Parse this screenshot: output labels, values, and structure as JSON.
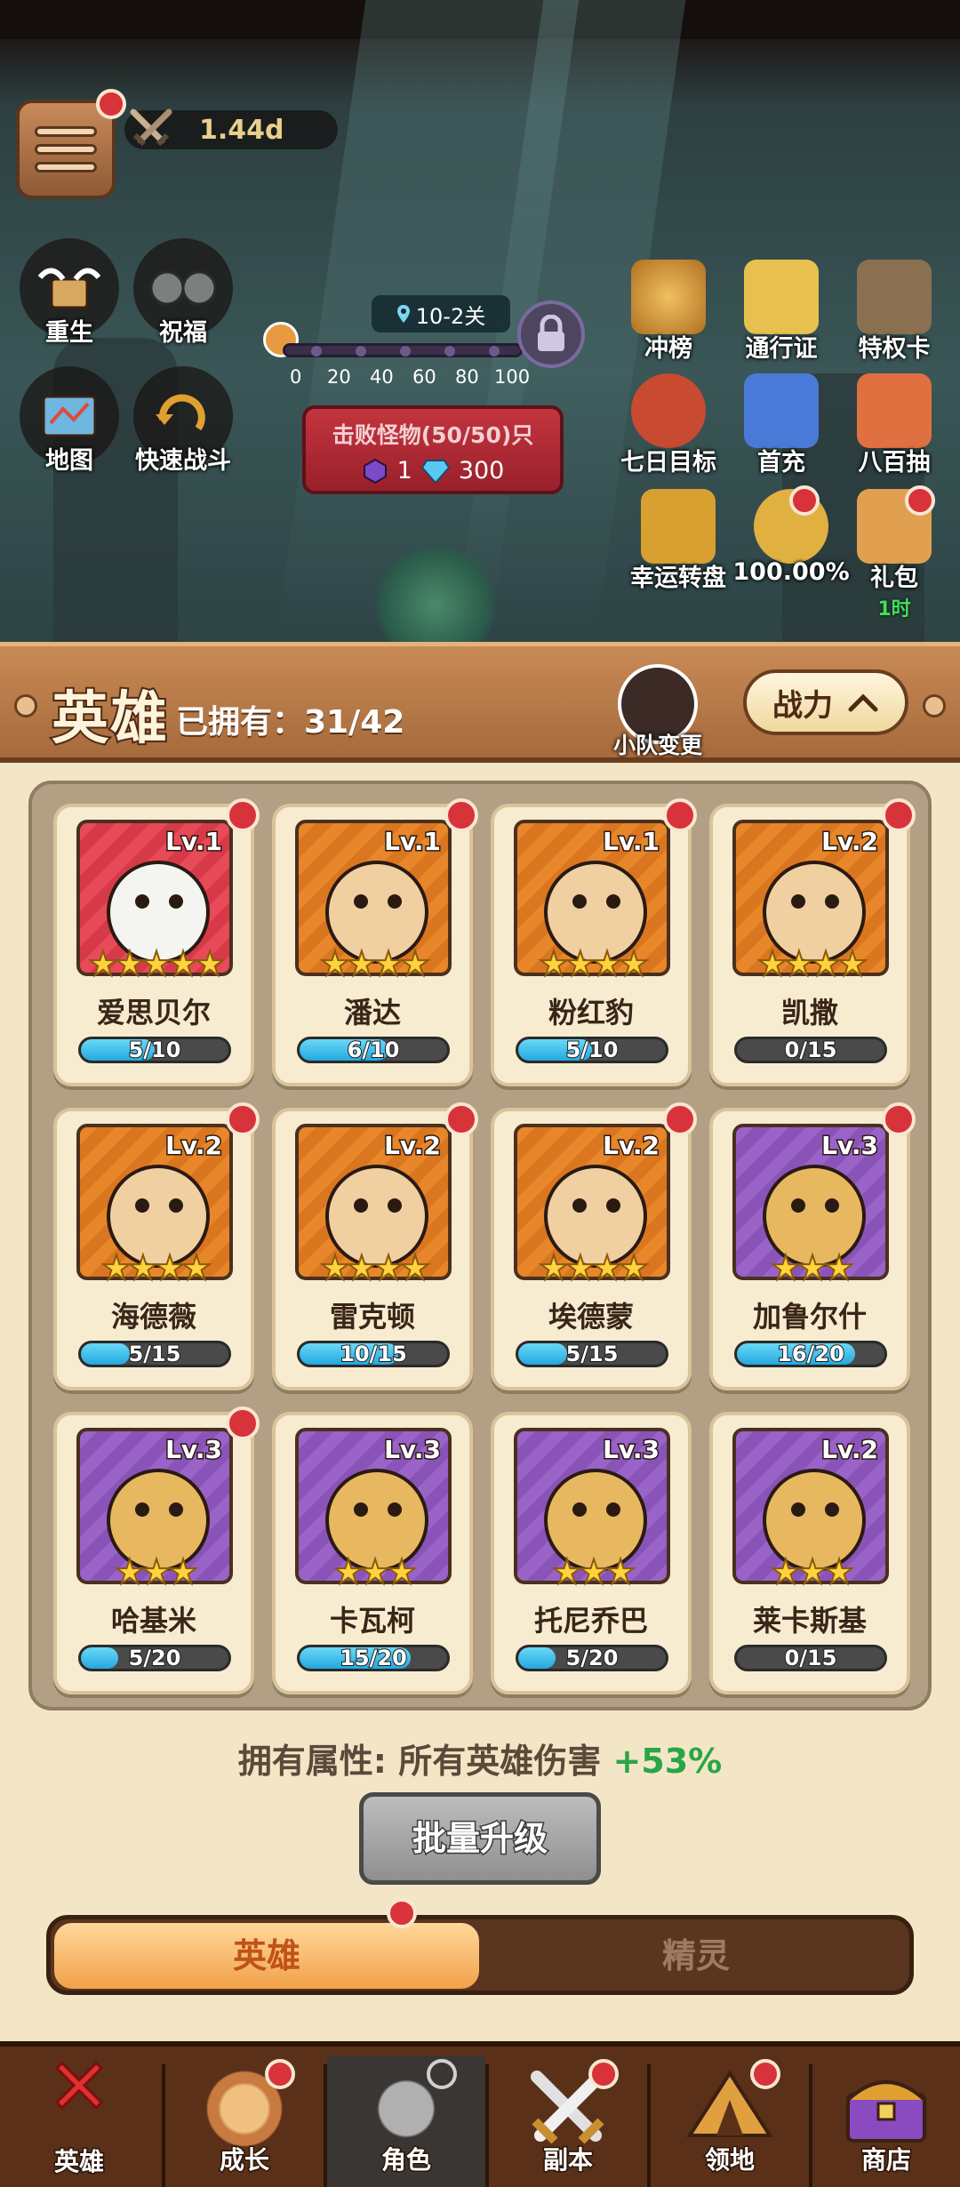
{
  "top": {
    "power_value": "1.44d",
    "left_buttons": [
      {
        "label": "重生",
        "icon": "angel-chest-icon"
      },
      {
        "label": "祝福",
        "icon": "blessing-icon"
      },
      {
        "label": "地图",
        "icon": "map-icon"
      },
      {
        "label": "快速战斗",
        "icon": "fast-battle-icon"
      }
    ],
    "stage": {
      "label": "10-2关",
      "ticks": [
        "0",
        "20",
        "40",
        "60",
        "80",
        "100"
      ]
    },
    "defeat": {
      "title": "击败怪物(50/50)只",
      "gem_count": "1",
      "diamond_count": "300"
    },
    "events": [
      {
        "label": "冲榜",
        "icon": "rank-trophy-icon"
      },
      {
        "label": "通行证",
        "icon": "pass-ticket-icon"
      },
      {
        "label": "特权卡",
        "icon": "privilege-card-icon"
      },
      {
        "label": "七日目标",
        "icon": "seven-day-goal-icon"
      },
      {
        "label": "首充",
        "icon": "first-recharge-icon"
      },
      {
        "label": "八百抽",
        "icon": "eight-hundred-draws-icon"
      },
      {
        "label": "幸运转盘",
        "icon": "lucky-wheel-icon"
      },
      {
        "label": "100.00%",
        "icon": "bonus-percent-icon"
      },
      {
        "label": "礼包",
        "icon": "gift-pack-icon",
        "timer": "1时"
      }
    ]
  },
  "panel": {
    "title": "英雄",
    "owned": "已拥有：31/42",
    "team_change": "小队变更",
    "sort_label": "战力"
  },
  "heroes": [
    {
      "name": "爱思贝尔",
      "level": "Lv.1",
      "stars": "★★★★★",
      "progress": "5/10",
      "fill": 0.5,
      "color": "red"
    },
    {
      "name": "潘达",
      "level": "Lv.1",
      "stars": "★★★★",
      "progress": "6/10",
      "fill": 0.6,
      "color": "orange"
    },
    {
      "name": "粉红豹",
      "level": "Lv.1",
      "stars": "★★★★",
      "progress": "5/10",
      "fill": 0.5,
      "color": "orange"
    },
    {
      "name": "凯撒",
      "level": "Lv.2",
      "stars": "★★★★",
      "progress": "0/15",
      "fill": 0,
      "color": "orange"
    },
    {
      "name": "海德薇",
      "level": "Lv.2",
      "stars": "★★★★",
      "progress": "5/15",
      "fill": 0.333,
      "color": "orange"
    },
    {
      "name": "雷克顿",
      "level": "Lv.2",
      "stars": "★★★★",
      "progress": "10/15",
      "fill": 0.667,
      "color": "orange"
    },
    {
      "name": "埃德蒙",
      "level": "Lv.2",
      "stars": "★★★★",
      "progress": "5/15",
      "fill": 0.333,
      "color": "orange"
    },
    {
      "name": "加鲁尔什",
      "level": "Lv.3",
      "stars": "★★★",
      "progress": "16/20",
      "fill": 0.8,
      "color": "purple"
    },
    {
      "name": "哈基米",
      "level": "Lv.3",
      "stars": "★★★",
      "progress": "5/20",
      "fill": 0.25,
      "color": "purple"
    },
    {
      "name": "卡瓦柯",
      "level": "Lv.3",
      "stars": "★★★",
      "progress": "15/20",
      "fill": 0.75,
      "color": "purple"
    },
    {
      "name": "托尼乔巴",
      "level": "Lv.3",
      "stars": "★★★",
      "progress": "5/20",
      "fill": 0.25,
      "color": "purple"
    },
    {
      "name": "莱卡斯基",
      "level": "Lv.2",
      "stars": "★★★",
      "progress": "0/15",
      "fill": 0,
      "color": "purple"
    }
  ],
  "attributes": {
    "label": "拥有属性: 所有英雄伤害 ",
    "bonus": "+53%"
  },
  "batch_upgrade": "批量升级",
  "tabs": {
    "hero": "英雄",
    "spirit": "精灵"
  },
  "nav": [
    {
      "label": "英雄",
      "icon": "close-icon"
    },
    {
      "label": "成长",
      "icon": "growth-icon"
    },
    {
      "label": "角色",
      "icon": "helmet-icon"
    },
    {
      "label": "副本",
      "icon": "crossed-swords-icon"
    },
    {
      "label": "领地",
      "icon": "tent-icon"
    },
    {
      "label": "商店",
      "icon": "treasure-chest-icon"
    }
  ],
  "colors": {
    "accent": "#f2a14a",
    "alert": "#d8323a",
    "bonus": "#2aa548",
    "bar": "#22a8e0"
  }
}
